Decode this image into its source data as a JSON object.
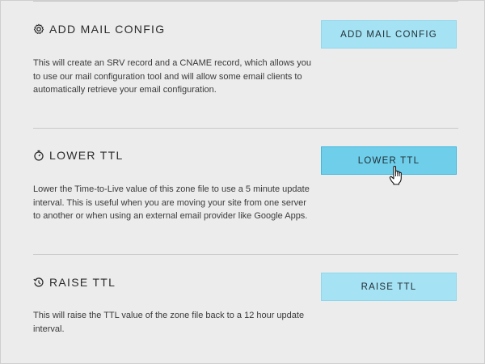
{
  "sections": [
    {
      "title": "ADD MAIL CONFIG",
      "icon": "gear-icon",
      "description": "This will create an SRV record and a CNAME record, which allows you to use our mail configuration tool and will allow some email clients to automatically retrieve your email configuration.",
      "button_label": "ADD MAIL CONFIG"
    },
    {
      "title": "LOWER TTL",
      "icon": "stopwatch-icon",
      "description": "Lower the Time-to-Live value of this zone file to use a 5 minute update interval. This is useful when you are moving your site from one server to another or when using an external email provider like Google Apps.",
      "button_label": "LOWER TTL"
    },
    {
      "title": "RAISE TTL",
      "icon": "history-icon",
      "description": "This will raise the TTL value of the zone file back to a 12 hour update interval.",
      "button_label": "RAISE TTL"
    }
  ],
  "colors": {
    "button_bg": "#a5e3f4",
    "button_active_bg": "#6fcfeb",
    "page_bg": "#ececec"
  },
  "cursor": "hand-pointer-icon"
}
